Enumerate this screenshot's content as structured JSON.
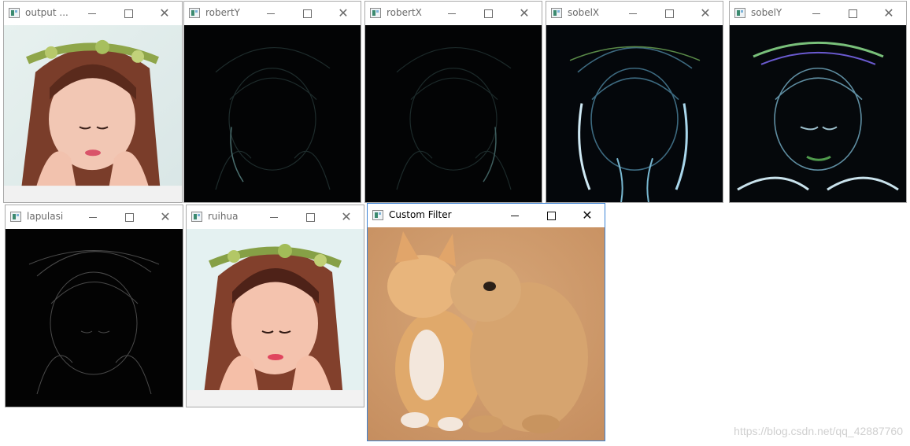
{
  "windows": [
    {
      "id": "output",
      "title": "output ..."
    },
    {
      "id": "robertY",
      "title": "robertY"
    },
    {
      "id": "robertX",
      "title": "robertX"
    },
    {
      "id": "sobelX",
      "title": "sobelX"
    },
    {
      "id": "sobelY",
      "title": "sobelY"
    },
    {
      "id": "lapulasi",
      "title": "lapulasi"
    },
    {
      "id": "ruihua",
      "title": "ruihua"
    },
    {
      "id": "custom",
      "title": "Custom Filter"
    }
  ],
  "controls": {
    "minimize": "—",
    "maximize": "☐",
    "close": "✕"
  },
  "watermark": "https://blog.csdn.net/qq_42887760"
}
